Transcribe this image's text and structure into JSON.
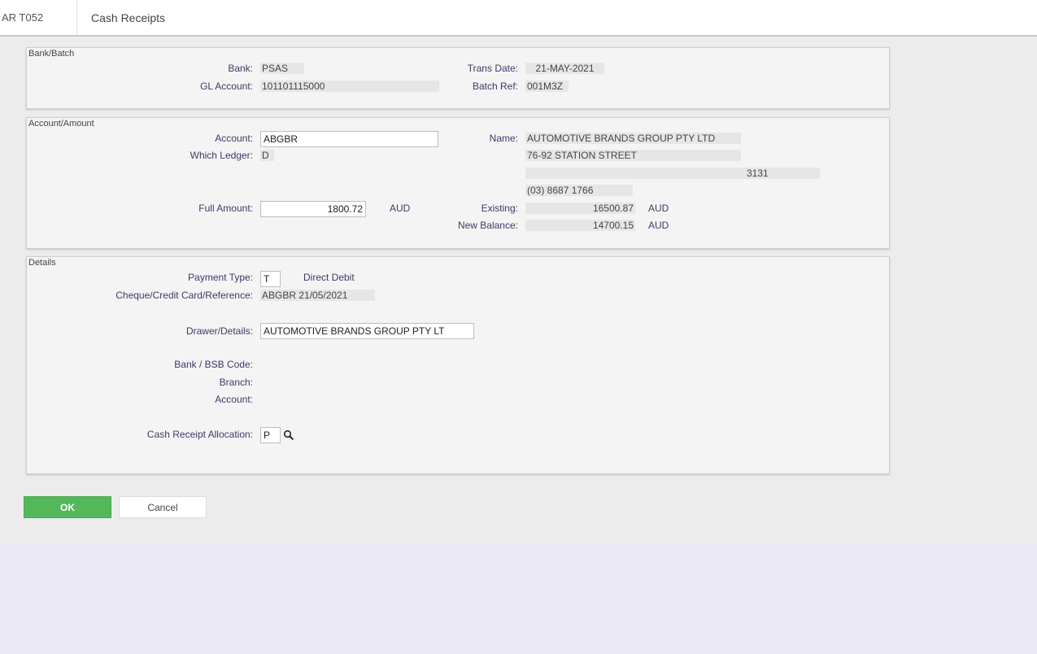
{
  "header": {
    "code": "AR T052",
    "title": "Cash Receipts"
  },
  "bank_batch": {
    "legend": "Bank/Batch",
    "bank_label": "Bank:",
    "bank_value": "PSAS",
    "trans_date_label": "Trans Date:",
    "trans_date_value": "21-MAY-2021",
    "gl_account_label": "GL Account:",
    "gl_account_value": "101101115000",
    "batch_ref_label": "Batch Ref:",
    "batch_ref_value": "001M3Z"
  },
  "account_amount": {
    "legend": "Account/Amount",
    "account_label": "Account:",
    "account_value": "ABGBR",
    "which_ledger_label": "Which Ledger:",
    "which_ledger_value": "D",
    "name_label": "Name:",
    "name_value": "AUTOMOTIVE BRANDS GROUP PTY LTD",
    "address_line1": "76-92 STATION STREET",
    "address_line2": "",
    "postcode": "3131",
    "phone": "(03) 8687 1766",
    "full_amount_label": "Full Amount:",
    "full_amount_value": "1800.72",
    "full_amount_currency": "AUD",
    "existing_label": "Existing:",
    "existing_value": "16500.87",
    "existing_currency": "AUD",
    "new_balance_label": "New Balance:",
    "new_balance_value": "14700.15",
    "new_balance_currency": "AUD"
  },
  "details": {
    "legend": "Details",
    "payment_type_label": "Payment Type:",
    "payment_type_value": "T",
    "payment_type_desc": "Direct Debit",
    "reference_label": "Cheque/Credit Card/Reference:",
    "reference_value": "ABGBR 21/05/2021",
    "drawer_label": "Drawer/Details:",
    "drawer_value": "AUTOMOTIVE BRANDS GROUP PTY LT",
    "bsb_label": "Bank / BSB Code:",
    "branch_label": "Branch:",
    "account_label": "Account:",
    "allocation_label": "Cash Receipt Allocation:",
    "allocation_value": "P"
  },
  "buttons": {
    "ok": "OK",
    "cancel": "Cancel"
  },
  "icons": {
    "allocation_lookup": "search-icon"
  },
  "colors": {
    "ok_button": "#53b85a",
    "label_text": "#3d3a6a",
    "page_bg": "#eae9f3"
  }
}
